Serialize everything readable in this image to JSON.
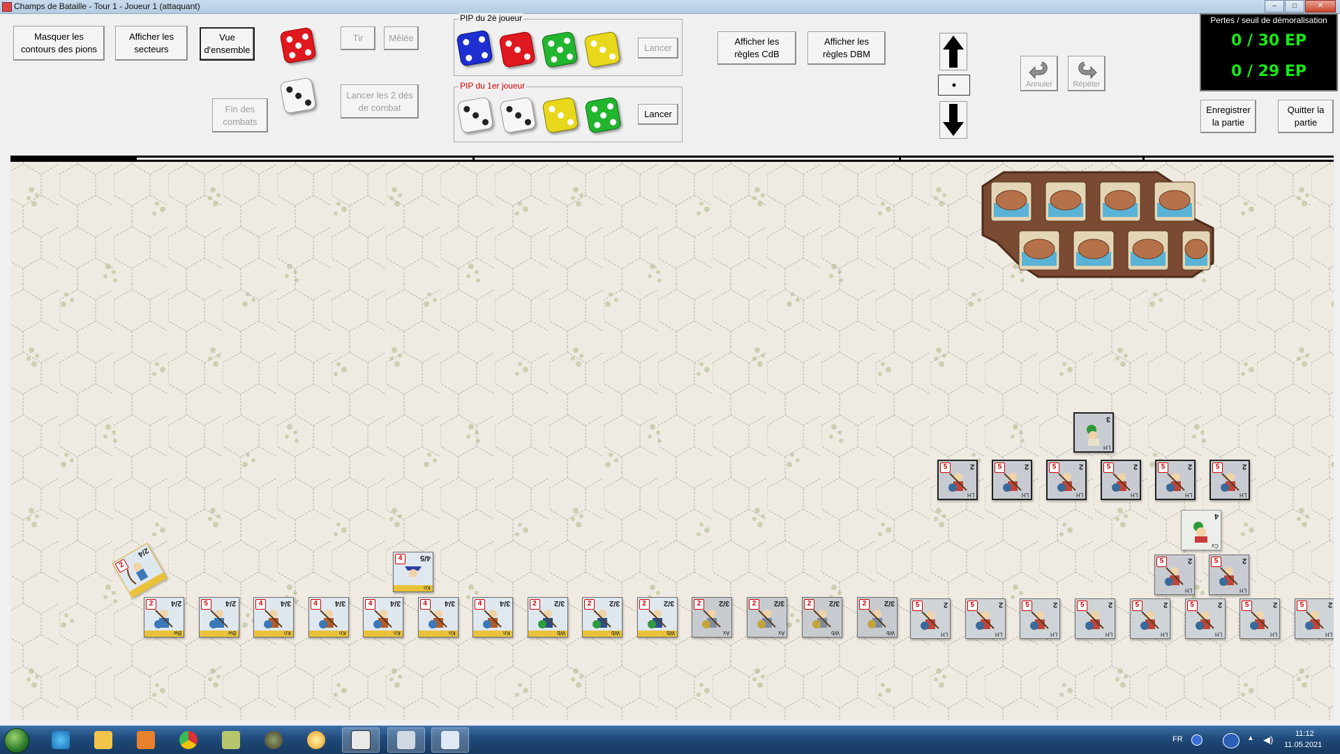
{
  "window": {
    "title": "Champs de Bataille - Tour 1 - Joueur 1 (attaquant)",
    "minimize": "–",
    "maximize": "□",
    "close": "✕"
  },
  "toolbar": {
    "hide_outlines": "Masquer les\ncontours des pions",
    "show_sectors": "Afficher les\nsecteurs",
    "overview": "Vue\nd'ensemble",
    "shoot": "Tir",
    "melee": "Mêlée",
    "end_combat": "Fin des\ncombats",
    "roll_two": "Lancer les 2 dés\nde combat",
    "rules_cdb": "Afficher les\nrègles CdB",
    "rules_dbm": "Afficher les\nrègles DBM",
    "undo": "Annuler",
    "redo": "Répéter",
    "save": "Enregistrer\nla partie",
    "quit": "Quitter la\npartie"
  },
  "pip_player2": {
    "label": "PIP du 2è joueur",
    "roll": "Lancer",
    "dice": [
      4,
      3,
      5,
      3
    ]
  },
  "pip_player1": {
    "label": "PIP du 1er joueur",
    "roll": "Lancer",
    "dice": [
      3,
      3,
      3,
      5
    ]
  },
  "combat_dice": {
    "red": 5,
    "white": 3
  },
  "losses": {
    "title": "Pertes / seuil de démoralisation",
    "player1": "0 / 30 EP",
    "player2": "0 / 29 EP"
  },
  "counters": {
    "left_row": [
      {
        "badge": "2",
        "rating": "2/4",
        "type": "Bw"
      },
      {
        "badge": "5",
        "rating": "2/4",
        "type": "Bw"
      },
      {
        "badge": "4",
        "rating": "3/4",
        "type": "Kn"
      },
      {
        "badge": "4",
        "rating": "3/4",
        "type": "Kn"
      },
      {
        "badge": "4",
        "rating": "3/4",
        "type": "Kn"
      },
      {
        "badge": "4",
        "rating": "3/4",
        "type": "Kn"
      },
      {
        "badge": "4",
        "rating": "3/4",
        "type": "Kn"
      },
      {
        "badge": "2",
        "rating": "3/2",
        "type": "Wb"
      },
      {
        "badge": "2",
        "rating": "3/2",
        "type": "Wb"
      },
      {
        "badge": "2",
        "rating": "3/2",
        "type": "Wb"
      }
    ],
    "grey_row": [
      {
        "badge": "2",
        "rating": "3/2",
        "type": "Ax"
      },
      {
        "badge": "2",
        "rating": "3/2",
        "type": "Ax"
      },
      {
        "badge": "2",
        "rating": "3/2",
        "type": "Wb"
      },
      {
        "badge": "2",
        "rating": "3/2",
        "type": "Wb"
      }
    ],
    "enemy_row": [
      {
        "badge": "5",
        "rating": "2",
        "type": "LH"
      },
      {
        "badge": "5",
        "rating": "2",
        "type": "LH"
      },
      {
        "badge": "5",
        "rating": "2",
        "type": "LH"
      },
      {
        "badge": "5",
        "rating": "2",
        "type": "LH"
      },
      {
        "badge": "5",
        "rating": "2",
        "type": "LH"
      },
      {
        "badge": "5",
        "rating": "2",
        "type": "LH"
      },
      {
        "badge": "5",
        "rating": "2",
        "type": "LH"
      },
      {
        "badge": "5",
        "rating": "2",
        "type": "LH"
      }
    ],
    "enemy_block": [
      {
        "badge": "5",
        "rating": "2",
        "type": "LH"
      },
      {
        "badge": "5",
        "rating": "2",
        "type": "LH"
      },
      {
        "badge": "5",
        "rating": "2",
        "type": "LH"
      },
      {
        "badge": "5",
        "rating": "2",
        "type": "LH"
      },
      {
        "badge": "5",
        "rating": "2",
        "type": "LH"
      },
      {
        "badge": "5",
        "rating": "2",
        "type": "LH"
      }
    ],
    "enemy_pair": [
      {
        "badge": "5",
        "rating": "2",
        "type": "LH"
      },
      {
        "badge": "5",
        "rating": "2",
        "type": "LH"
      }
    ],
    "general_top": {
      "badge": "",
      "rating": "3",
      "type": "LH"
    },
    "general_mid": {
      "badge": "",
      "rating": "4",
      "type": "Cv"
    },
    "lone_left": {
      "badge": "4",
      "rating": "4/5",
      "type": "Kn"
    },
    "tilted": {
      "badge": "2",
      "rating": "2/4",
      "type": "Bw"
    }
  },
  "taskbar": {
    "lang": "FR",
    "time": "11:12",
    "date": "11.05.2021"
  },
  "colors": {
    "board_bg": "#efebe2",
    "loss_text": "#16e816",
    "pip2_label": "#000000",
    "pip1_label": "#cc0000"
  }
}
